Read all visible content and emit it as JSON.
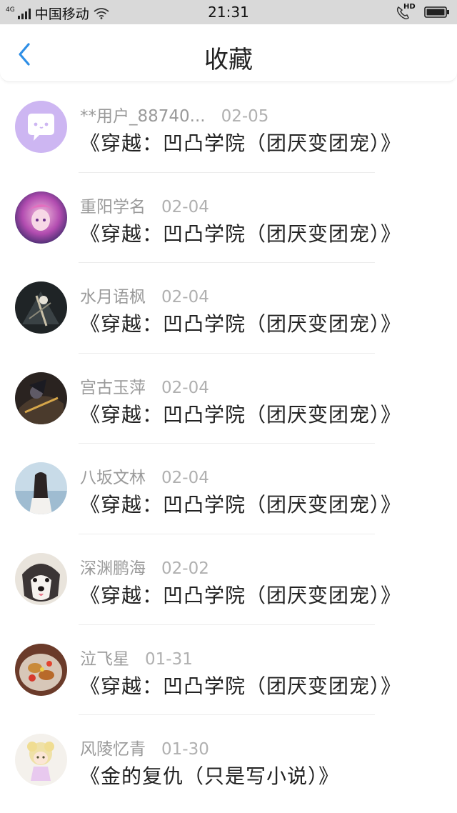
{
  "status_bar": {
    "network": "4G",
    "carrier": "中国移动",
    "time": "21:31",
    "call_badge": "HD"
  },
  "nav": {
    "title": "收藏",
    "back_icon": "chevron-left-icon",
    "accent_color": "#2f8fe6"
  },
  "items": [
    {
      "user": "**用户_88740...",
      "date": "02-05",
      "title": "《穿越：凹凸学院（团厌变团宠）》",
      "avatar": "chat-bubble"
    },
    {
      "user": "重阳学名",
      "date": "02-04",
      "title": "《穿越：凹凸学院（团厌变团宠）》",
      "avatar": "anime-girl-pink"
    },
    {
      "user": "水月语枫",
      "date": "02-04",
      "title": "《穿越：凹凸学院（团厌变团宠）》",
      "avatar": "dark-anime"
    },
    {
      "user": "宫古玉萍",
      "date": "02-04",
      "title": "《穿越：凹凸学院（团厌变团宠）》",
      "avatar": "dark-warrior"
    },
    {
      "user": "八坂文林",
      "date": "02-04",
      "title": "《穿越：凹凸学院（团厌变团宠）》",
      "avatar": "girl-seaside"
    },
    {
      "user": "深渊鹏海",
      "date": "02-02",
      "title": "《穿越：凹凸学院（团厌变团宠）》",
      "avatar": "husky-dog"
    },
    {
      "user": "泣飞星",
      "date": "01-31",
      "title": "《穿越：凹凸学院（团厌变团宠）》",
      "avatar": "food-plate"
    },
    {
      "user": "风陵忆青",
      "date": "01-30",
      "title": "《金的复仇（只是写小说）》",
      "avatar": "chibi-character"
    }
  ]
}
